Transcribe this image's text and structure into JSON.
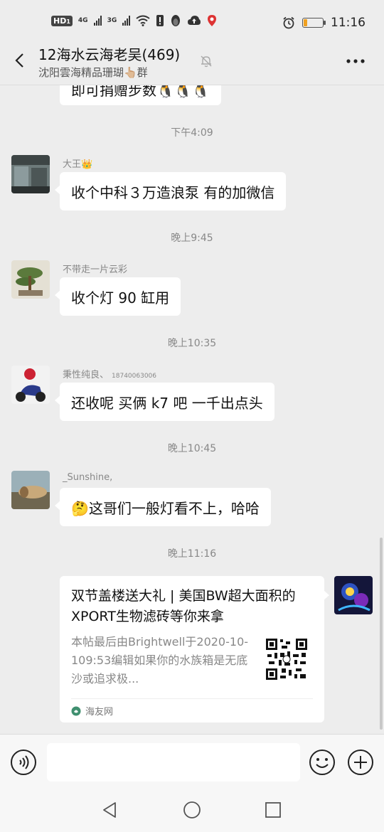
{
  "status_bar": {
    "badge": "HD",
    "badge_sub": "1",
    "net_1": "4G",
    "net_2": "3G",
    "time": "11:16",
    "battery_level": 0.18,
    "icons": [
      "wifi-icon",
      "alert-icon",
      "penguin-icon",
      "cloud-upload-icon",
      "location-icon",
      "alarm-icon",
      "battery-icon"
    ]
  },
  "header": {
    "title": "12海水云海老吴(469)",
    "subtitle": "沈阳雲海精品珊瑚👆🏼群"
  },
  "messages": [
    {
      "kind": "text",
      "side": "left",
      "text": "即可捐赠步数🐧🐧🐧"
    },
    {
      "kind": "time",
      "text": "下午4:09"
    },
    {
      "kind": "text",
      "side": "left",
      "sender": "大王👑",
      "text": "收个中科３万造浪泵  有的加微信"
    },
    {
      "kind": "time",
      "text": "晚上9:45"
    },
    {
      "kind": "text",
      "side": "left",
      "sender": "不带走一片云彩",
      "text": "收个灯 90 缸用"
    },
    {
      "kind": "time",
      "text": "晚上10:35"
    },
    {
      "kind": "text",
      "side": "left",
      "sender": "秉性纯良、",
      "sender_extra": "18740063006",
      "text": "还收呢 买俩 k7 吧 一千出点头"
    },
    {
      "kind": "time",
      "text": "晚上10:45"
    },
    {
      "kind": "text",
      "side": "left",
      "sender": "_Sunshine,",
      "text": "🤔这哥们一般灯看不上，哈哈"
    },
    {
      "kind": "time",
      "text": "晚上11:16"
    }
  ],
  "link_card": {
    "title": "双节盖楼送大礼 | 美国BW超大面积的XPORT生物滤砖等你来拿",
    "desc": "本帖最后由Brightwell于2020-10-109:53编辑如果你的水族箱是无底沙或追求极...",
    "source": "海友网"
  },
  "input_bar": {
    "placeholder": ""
  },
  "colors": {
    "background": "#ededed",
    "bubble": "#ffffff",
    "time_text": "#888888",
    "battery_fill": "#f0a020"
  }
}
